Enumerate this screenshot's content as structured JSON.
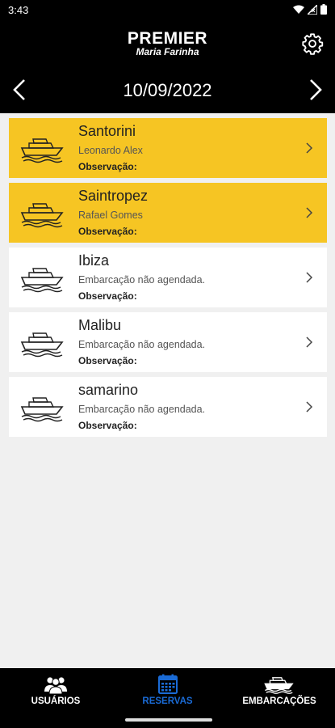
{
  "status_bar": {
    "time": "3:43"
  },
  "header": {
    "logo_main": "PREMIER",
    "logo_sub": "Maria Farinha",
    "settings_icon": "gear-icon"
  },
  "date_nav": {
    "date": "10/09/2022",
    "prev_icon": "chevron-left-icon",
    "next_icon": "chevron-right-icon"
  },
  "colors": {
    "reserved": "#f6c523",
    "free": "#ffffff",
    "active_nav": "#1a6bd6",
    "bar": "#000000"
  },
  "boats": [
    {
      "name": "Santorini",
      "detail": "Leonardo Alex",
      "obs_label": "Observação:",
      "status": "reserved"
    },
    {
      "name": "Saintropez",
      "detail": "Rafael Gomes",
      "obs_label": "Observação:",
      "status": "reserved"
    },
    {
      "name": "Ibiza",
      "detail": "Embarcação não agendada.",
      "obs_label": "Observação:",
      "status": "free"
    },
    {
      "name": "Malibu",
      "detail": "Embarcação não agendada.",
      "obs_label": "Observação:",
      "status": "free"
    },
    {
      "name": "samarino",
      "detail": "Embarcação não agendada.",
      "obs_label": "Observação:",
      "status": "free"
    }
  ],
  "bottom_nav": [
    {
      "label": "USUÁRIOS",
      "icon": "users-icon",
      "active": false
    },
    {
      "label": "RESERVAS",
      "icon": "calendar-icon",
      "active": true
    },
    {
      "label": "EMBARCAÇÕES",
      "icon": "boat-icon",
      "active": false
    }
  ]
}
